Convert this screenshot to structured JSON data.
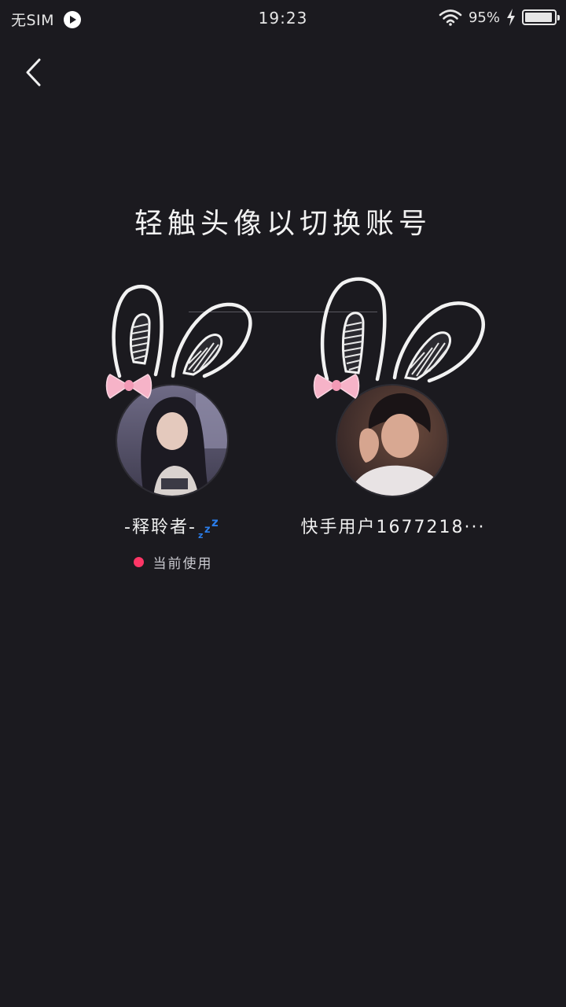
{
  "status_bar": {
    "carrier": "无SIM",
    "time": "19:23",
    "battery_percent": "95%",
    "battery_level": 0.95,
    "charging": true
  },
  "nav": {
    "back_icon": "chevron-left-icon"
  },
  "page": {
    "title": "轻触头像以切换账号"
  },
  "accounts": [
    {
      "name": "-释聆者-",
      "name_emoji": "zzz-icon",
      "status": "当前使用",
      "status_color": "#fe3666",
      "active": true
    },
    {
      "name": "快手用户1677218···",
      "active": false
    }
  ],
  "colors": {
    "background": "#1b1a1f",
    "accent": "#fe3666",
    "bow": "#f6b3c8"
  }
}
